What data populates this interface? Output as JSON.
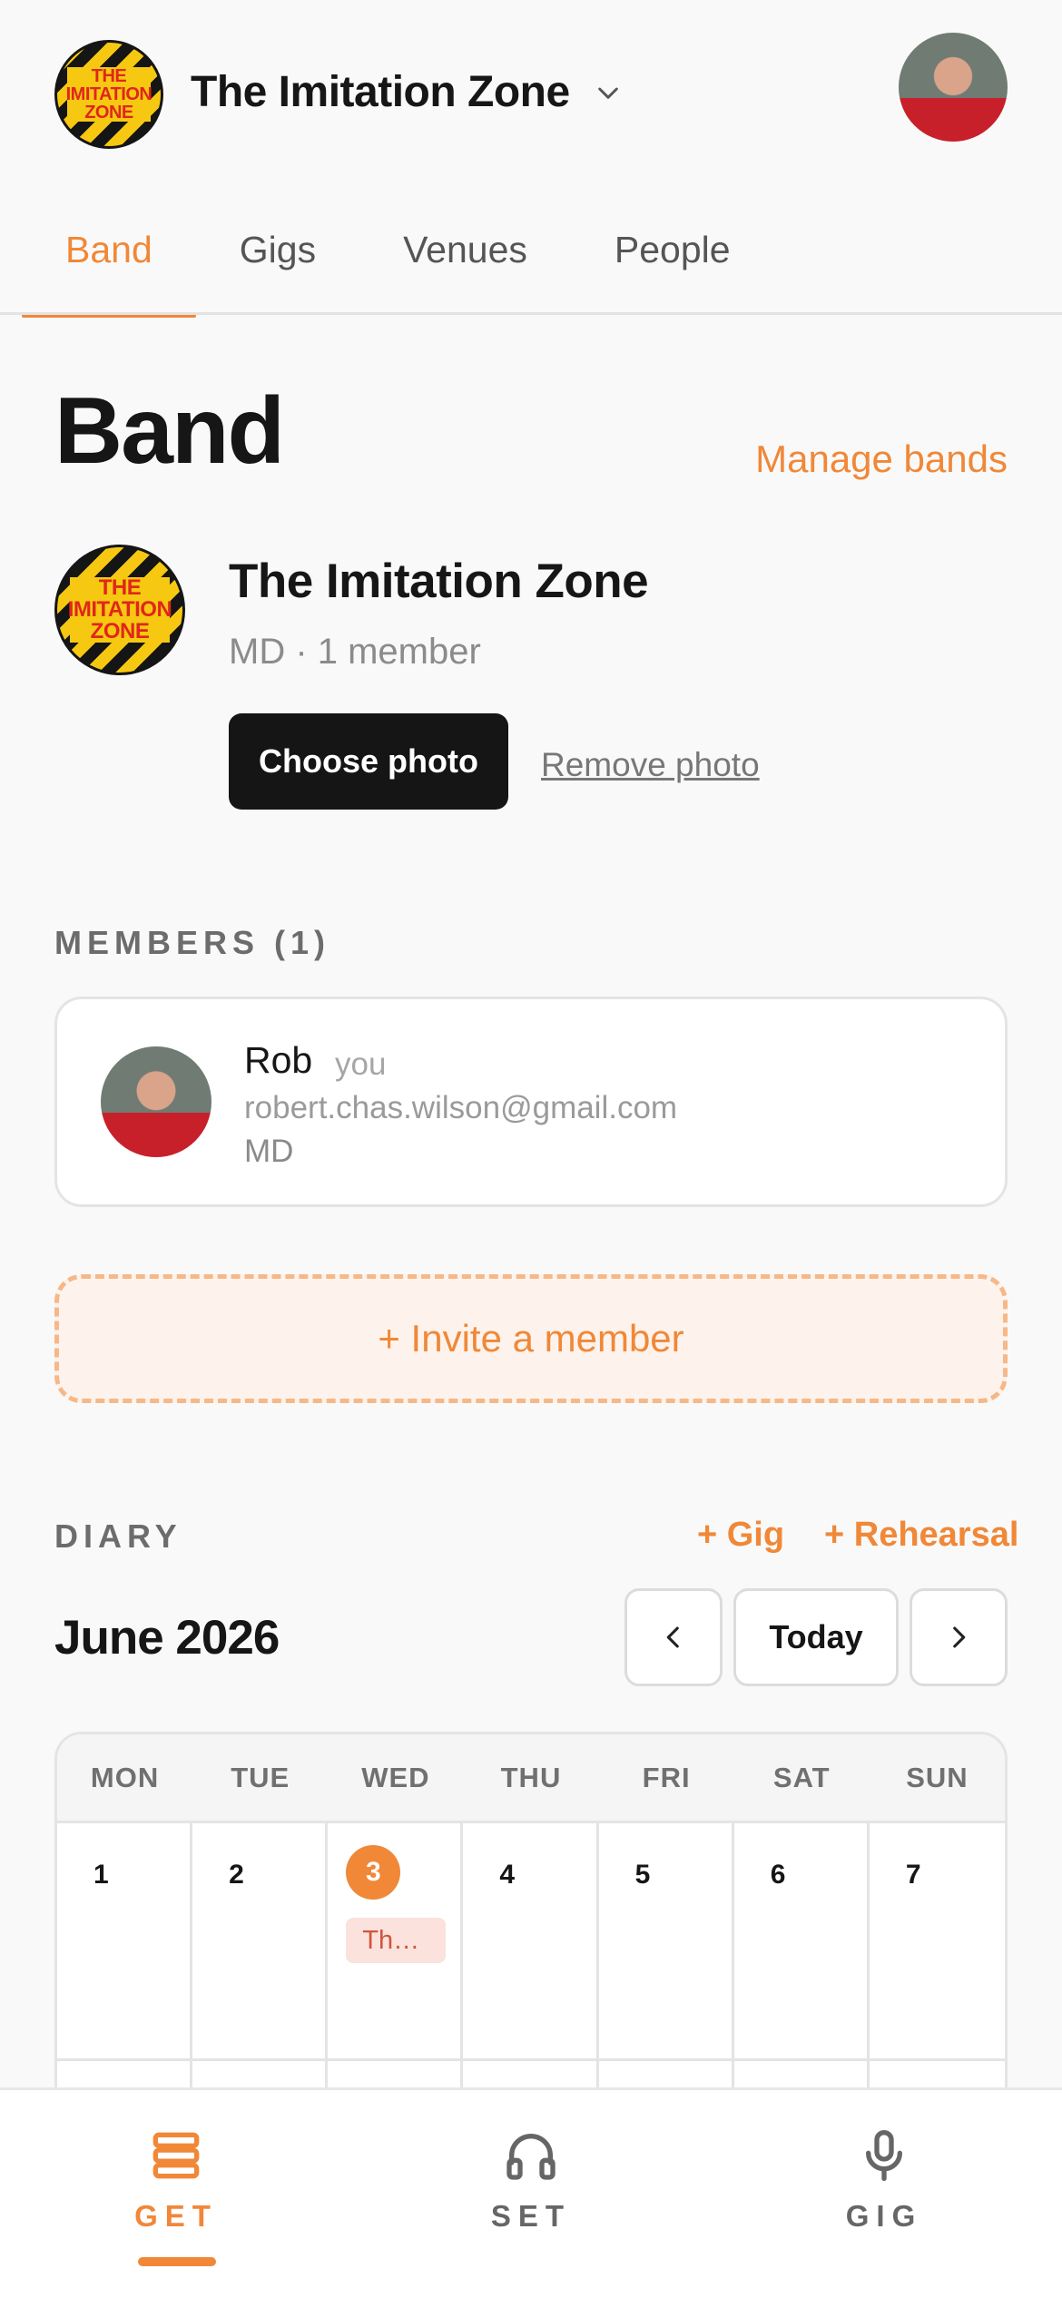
{
  "header": {
    "band_logo_text": [
      "THE",
      "IMITATION",
      "ZONE"
    ],
    "band_switcher_label": "The Imitation Zone"
  },
  "tabs": [
    {
      "label": "Band",
      "active": true
    },
    {
      "label": "Gigs",
      "active": false
    },
    {
      "label": "Venues",
      "active": false
    },
    {
      "label": "People",
      "active": false
    }
  ],
  "band": {
    "heading": "Band",
    "manage_link": "Manage bands",
    "name": "The Imitation Zone",
    "meta": "MD · 1 member",
    "choose_photo": "Choose photo",
    "remove_photo": "Remove photo"
  },
  "members": {
    "label": "MEMBERS (1)",
    "items": [
      {
        "name": "Rob",
        "you_tag": "you",
        "email": "robert.chas.wilson@gmail.com",
        "role": "MD"
      }
    ],
    "invite_label": "+ Invite a member"
  },
  "diary": {
    "label": "DIARY",
    "add_gig": "+ Gig",
    "add_rehearsal": "+ Rehearsal",
    "month": "June 2026",
    "prev": "‹",
    "today": "Today",
    "next": "›",
    "weekdays": [
      "MON",
      "TUE",
      "WED",
      "THU",
      "FRI",
      "SAT",
      "SUN"
    ],
    "week1": [
      "1",
      "2",
      "3",
      "4",
      "5",
      "6",
      "7"
    ],
    "today_index": 2,
    "event_on_3": "Th…"
  },
  "bottom_nav": [
    {
      "label": "GET",
      "icon": "stack-icon",
      "active": true
    },
    {
      "label": "SET",
      "icon": "headphones-icon",
      "active": false
    },
    {
      "label": "GIG",
      "icon": "microphone-icon",
      "active": false
    }
  ],
  "colors": {
    "accent": "#f08838",
    "dark": "#151515",
    "event_bg": "#fbe2dc"
  }
}
